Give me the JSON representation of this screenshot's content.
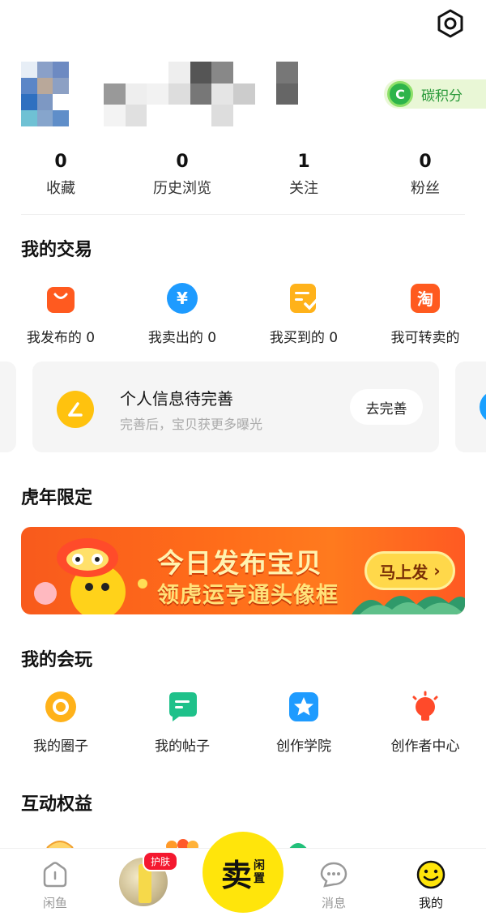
{
  "colors": {
    "accent": "#ffe50b",
    "carbon_green": "#2db44a",
    "banner_orange": "#ff6d1a"
  },
  "header": {
    "settings_icon": "hexagon-settings-icon"
  },
  "profile": {
    "carbon_label": "碳积分",
    "carbon_icon_letter": "C"
  },
  "stats": [
    {
      "value": "0",
      "label": "收藏"
    },
    {
      "value": "0",
      "label": "历史浏览"
    },
    {
      "value": "1",
      "label": "关注"
    },
    {
      "value": "0",
      "label": "粉丝"
    }
  ],
  "trade": {
    "title": "我的交易",
    "items": [
      {
        "label": "我发布的 0",
        "icon": "bag-icon"
      },
      {
        "label": "我卖出的 0",
        "icon": "yen-icon"
      },
      {
        "label": "我买到的 0",
        "icon": "checklist-icon"
      },
      {
        "label": "我可转卖的",
        "icon": "taobao-icon"
      }
    ]
  },
  "info_card": {
    "title": "个人信息待完善",
    "subtitle": "完善后，宝贝获更多曝光",
    "button": "去完善"
  },
  "tiger": {
    "title": "虎年限定",
    "banner_title": "今日发布宝贝",
    "banner_sub": "领虎运亨通头像框",
    "banner_button": "马上发"
  },
  "play": {
    "title": "我的会玩",
    "items": [
      {
        "label": "我的圈子",
        "icon": "circle-icon"
      },
      {
        "label": "我的帖子",
        "icon": "post-icon"
      },
      {
        "label": "创作学院",
        "icon": "star-icon"
      },
      {
        "label": "创作者中心",
        "icon": "bulb-icon"
      }
    ]
  },
  "benefits": {
    "title": "互动权益"
  },
  "bottom_nav": {
    "home": "闲鱼",
    "ad_badge": "护肤",
    "sell_big": "卖",
    "sell_small_1": "闲",
    "sell_small_2": "置",
    "messages": "消息",
    "mine": "我的"
  }
}
